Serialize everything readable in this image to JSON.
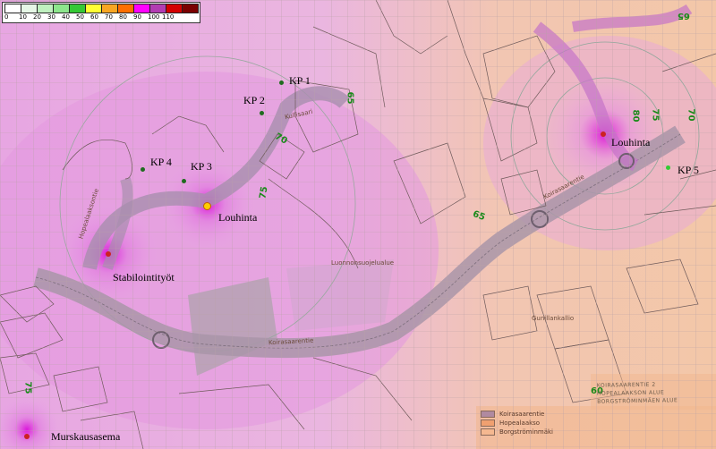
{
  "legend": {
    "ticks": [
      "0",
      "10",
      "20",
      "30",
      "40",
      "50",
      "60",
      "70",
      "80",
      "90",
      "100",
      "110"
    ],
    "colors": [
      "#ffffff",
      "#e6f7e6",
      "#bff0bf",
      "#8ce68c",
      "#35c835",
      "#ffff33",
      "#f7a623",
      "#ff6f00",
      "#ff00ff",
      "#b23cb2",
      "#d40000",
      "#7a0000"
    ]
  },
  "labels": {
    "kp1": "KP 1",
    "kp2": "KP 2",
    "kp3": "KP 3",
    "kp4": "KP 4",
    "kp5": "KP 5",
    "louhinta_west": "Louhinta",
    "louhinta_east": "Louhinta",
    "stabilointi": "Stabilointityöt",
    "murskausasema": "Murskausasema"
  },
  "streets": {
    "koirasaarentie": "Koirasaarentie",
    "koirasaarentie_east": "Koirasaarentie",
    "hopealaaksontie": "Hopealaaksontie",
    "luonnonsuojelualue": "Luonnonsuojelualue",
    "kullisaari": "Kullisaari",
    "gunillankallio": "Gunillankallio"
  },
  "contours": [
    "65",
    "70",
    "75",
    "65",
    "60",
    "65",
    "70",
    "75",
    "80",
    "75"
  ],
  "map_legend": {
    "items": [
      {
        "label": "Koirasaarentie",
        "color": "#b08aa0"
      },
      {
        "label": "Hopealaakso",
        "color": "#f0a070"
      },
      {
        "label": "Borgströminmäki",
        "color": "#f5b890"
      }
    ]
  },
  "title_block": {
    "line1": "KOIRASAARENTIE 2",
    "line2": "HOPEALAAKSON ALUE",
    "line3": "BORGSTRÖMINMÄEN ALUE"
  }
}
